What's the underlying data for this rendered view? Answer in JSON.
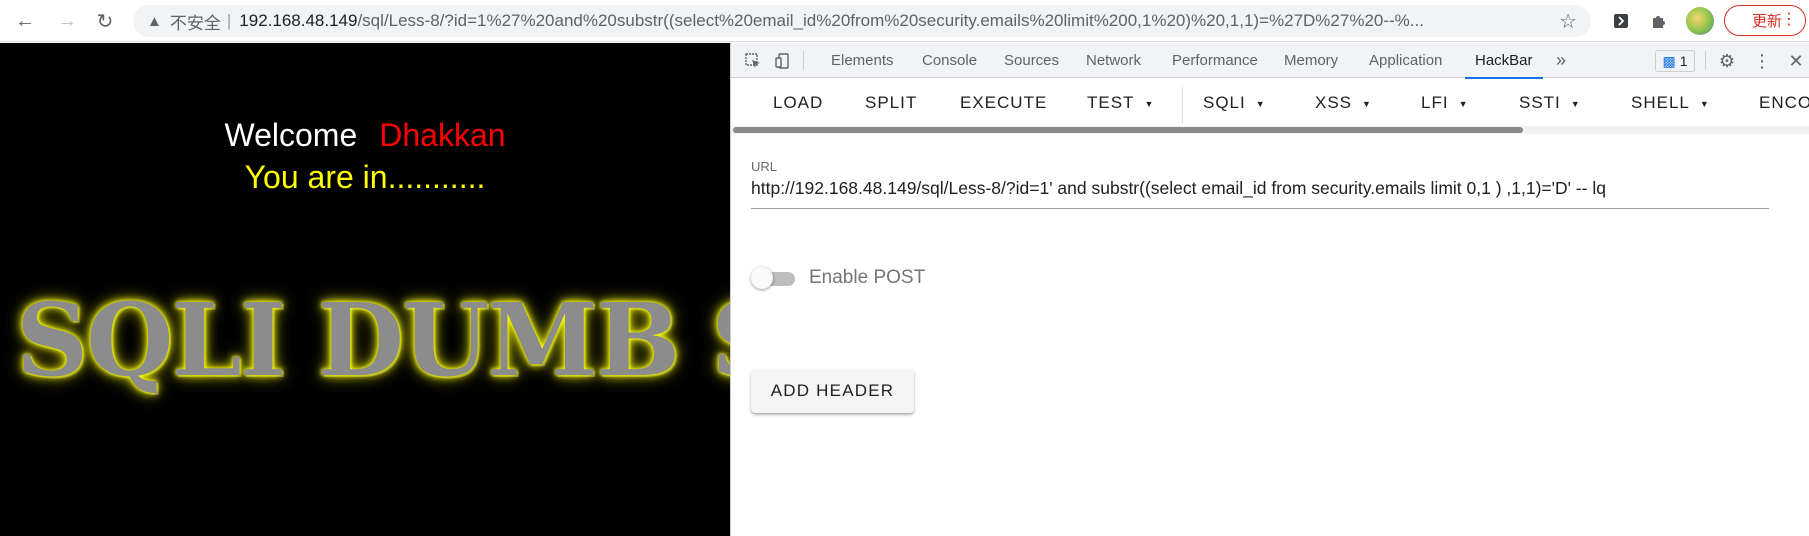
{
  "browser": {
    "insecure_label": "不安全",
    "separator": "|",
    "url_host": "192.168.48.149",
    "url_rest": "/sql/Less-8/?id=1%27%20and%20substr((select%20email_id%20from%20security.emails%20limit%200,1%20)%20,1,1)=%27D%27%20--%...",
    "update_label": "更新"
  },
  "page": {
    "welcome": "Welcome",
    "name": "Dhakkan",
    "status": "You are in...........",
    "banner": "SQLI DUMB S"
  },
  "devtools": {
    "tabs": [
      "Elements",
      "Console",
      "Sources",
      "Network",
      "Performance",
      "Memory",
      "Application",
      "HackBar"
    ],
    "active_tab": "HackBar",
    "more_tabs": "»",
    "message_count": "1"
  },
  "hackbar": {
    "menu": [
      "LOAD",
      "SPLIT",
      "EXECUTE",
      "TEST",
      "SQLI",
      "XSS",
      "LFI",
      "SSTI",
      "SHELL",
      "ENCO"
    ],
    "url_label": "URL",
    "url_value": "http://192.168.48.149/sql/Less-8/?id=1' and substr((select email_id from security.emails limit 0,1 ) ,1,1)='D' -- lq",
    "enable_post_label": "Enable POST",
    "enable_post": false,
    "add_header_label": "ADD HEADER"
  },
  "colors": {
    "accent": "#1a73e8",
    "welcome_name": "#ff0000",
    "status": "#ffff00"
  }
}
